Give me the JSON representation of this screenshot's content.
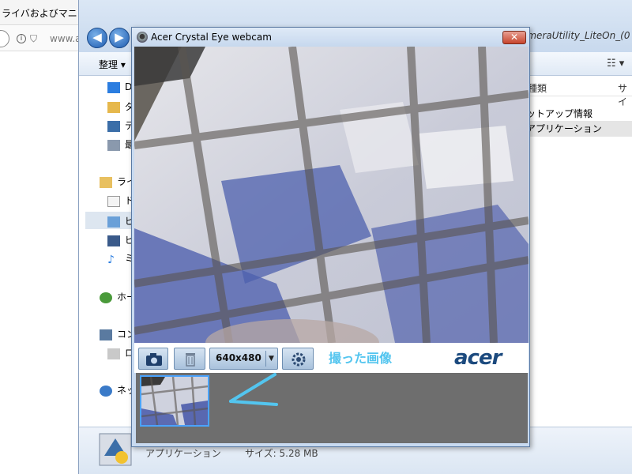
{
  "browser": {
    "tab_title": "ライバおよびマニ",
    "url_partial": "www.a"
  },
  "explorer": {
    "path_fragment": "ameraUtility_LiteOn_(0",
    "organize_label": "整理 ▾",
    "nav_items": [
      {
        "label": "D"
      },
      {
        "label": "ダ"
      },
      {
        "label": "デ"
      },
      {
        "label": "最"
      },
      {
        "label": "ライ"
      },
      {
        "label": "ド"
      },
      {
        "label": "ピ"
      },
      {
        "label": "ビ"
      },
      {
        "label": "ミ"
      },
      {
        "label": "ホー"
      },
      {
        "label": "コン"
      },
      {
        "label": "ロ"
      },
      {
        "label": "ネッ"
      }
    ],
    "columns": {
      "type": "種類",
      "size": "サイ"
    },
    "rows": [
      "ットアップ情報",
      "アプリケーション"
    ],
    "status": {
      "type": "アプリケーション",
      "size": "サイズ: 5.28 MB"
    }
  },
  "webcam": {
    "title": "Acer Crystal Eye webcam",
    "close_label": "✕",
    "resolution": "640x480",
    "annotation": "撮った画像",
    "logo_text": "acer"
  },
  "colors": {
    "accent": "#53c5ef",
    "acer_blue": "#1c4a7e",
    "thumbnail_border": "#4aa3ff",
    "gallery_bg": "#6e6e6e"
  }
}
